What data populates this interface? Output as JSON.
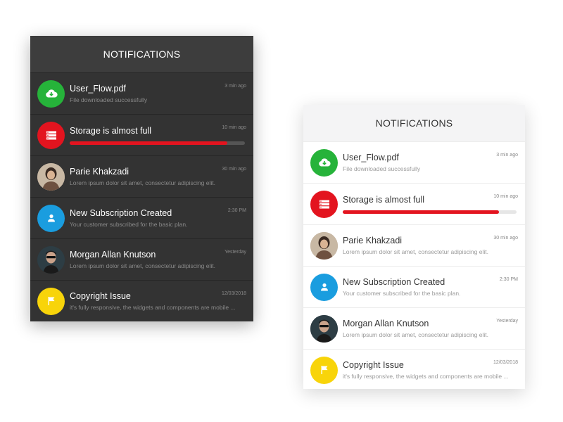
{
  "panels": [
    {
      "theme": "dark",
      "header": "NOTIFICATIONS",
      "items": [
        {
          "icon": "download-cloud-icon",
          "color": "#26b33a",
          "title": "User_Flow.pdf",
          "subtitle": "File downloaded successfully",
          "time": "3 min ago"
        },
        {
          "icon": "storage-icon",
          "color": "#e3141f",
          "title": "Storage is almost full",
          "time": "10 min ago",
          "progress": 0.9
        },
        {
          "icon": "user-photo",
          "title": "Parie Khakzadi",
          "subtitle": "Lorem ipsum dolor sit amet, consectetur adipiscing elit.",
          "time": "30 min ago"
        },
        {
          "icon": "user-icon",
          "color": "#1a9ddf",
          "title": "New Subscription Created",
          "subtitle": "Your customer subscribed for the basic plan.",
          "time": "2:30 PM"
        },
        {
          "icon": "user-photo",
          "title": "Morgan Allan Knutson",
          "subtitle": "Lorem ipsum dolor sit amet, consectetur adipiscing elit.",
          "time": "Yesterday"
        },
        {
          "icon": "flag-icon",
          "color": "#f8d40a",
          "title": "Copyright Issue",
          "subtitle": "it's fully responsive, the widgets and components are mobile ...",
          "time": "12/03/2018"
        }
      ]
    },
    {
      "theme": "light",
      "header": "NOTIFICATIONS",
      "items": [
        {
          "icon": "download-cloud-icon",
          "color": "#26b33a",
          "title": "User_Flow.pdf",
          "subtitle": "File downloaded successfully",
          "time": "3 min ago"
        },
        {
          "icon": "storage-icon",
          "color": "#e3141f",
          "title": "Storage is almost full",
          "time": "10 min ago",
          "progress": 0.9
        },
        {
          "icon": "user-photo",
          "title": "Parie Khakzadi",
          "subtitle": "Lorem ipsum dolor sit amet, consectetur adipiscing elit.",
          "time": "30 min ago"
        },
        {
          "icon": "user-icon",
          "color": "#1a9ddf",
          "title": "New Subscription Created",
          "subtitle": "Your customer subscribed for the basic plan.",
          "time": "2:30 PM"
        },
        {
          "icon": "user-photo",
          "title": "Morgan Allan Knutson",
          "subtitle": "Lorem ipsum dolor sit amet, consectetur adipiscing elit.",
          "time": "Yesterday"
        },
        {
          "icon": "flag-icon",
          "color": "#f8d40a",
          "title": "Copyright Issue",
          "subtitle": "it's fully responsive, the widgets and components are mobile ...",
          "time": "12/03/2018"
        }
      ]
    }
  ]
}
